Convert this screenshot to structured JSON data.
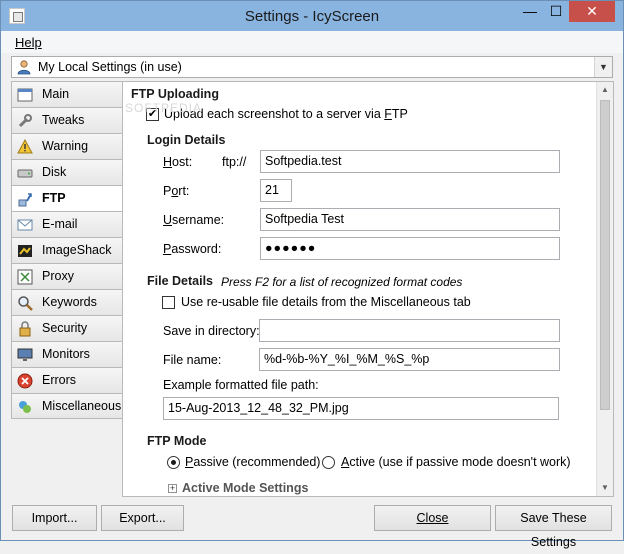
{
  "window": {
    "title": "Settings - IcyScreen"
  },
  "title_controls": {
    "minimize": "—",
    "maximize": "☐",
    "close": "✕"
  },
  "menu": {
    "help": "Help"
  },
  "profile": {
    "selected": "My Local Settings (in use)"
  },
  "watermark": "SOFTPEDIA",
  "sidebar": {
    "items": [
      {
        "label": "Main",
        "icon": "main-icon"
      },
      {
        "label": "Tweaks",
        "icon": "wrench-icon"
      },
      {
        "label": "Warning",
        "icon": "warning-icon"
      },
      {
        "label": "Disk",
        "icon": "disk-icon"
      },
      {
        "label": "FTP",
        "icon": "ftp-icon"
      },
      {
        "label": "E-mail",
        "icon": "email-icon"
      },
      {
        "label": "ImageShack",
        "icon": "imageshack-icon"
      },
      {
        "label": "Proxy",
        "icon": "proxy-icon"
      },
      {
        "label": "Keywords",
        "icon": "magnifier-icon"
      },
      {
        "label": "Security",
        "icon": "lock-icon"
      },
      {
        "label": "Monitors",
        "icon": "monitor-icon"
      },
      {
        "label": "Errors",
        "icon": "error-icon"
      },
      {
        "label": "Miscellaneous",
        "icon": "misc-icon"
      }
    ],
    "active": "FTP"
  },
  "ftp": {
    "section_title": "FTP Uploading",
    "upload_checkbox": {
      "label_pre": "Upload each screenshot to a server via ",
      "label_underlined": "F",
      "label_post": "TP",
      "checked": true
    },
    "login_title": "Login Details",
    "host": {
      "label_pre": "",
      "label_u": "H",
      "label_post": "ost:",
      "prefix": "ftp://",
      "value": "Softpedia.test"
    },
    "port": {
      "label_pre": "P",
      "label_u": "o",
      "label_post": "rt:",
      "value": "21"
    },
    "username": {
      "label_pre": "",
      "label_u": "U",
      "label_post": "sername:",
      "value": "Softpedia Test"
    },
    "password": {
      "label_pre": "",
      "label_u": "P",
      "label_post": "assword:",
      "value": "●●●●●●"
    },
    "file_title": "File Details",
    "file_hint": "Press F2 for a list of recognized format codes",
    "reuse_checkbox": {
      "label": "Use re-usable file details from the Miscellaneous tab",
      "checked": false
    },
    "save_dir": {
      "label": "Save in directory:",
      "value": ""
    },
    "file_name": {
      "label": "File name:",
      "value": "%d-%b-%Y_%I_%M_%S_%p"
    },
    "example_label": "Example formatted file path:",
    "example_value": "15-Aug-2013_12_48_32_PM.jpg",
    "mode_title": "FTP Mode",
    "passive": {
      "label_pre": "",
      "label_u": "P",
      "label_post": "assive (recommended)",
      "selected": true
    },
    "active": {
      "label_pre": "",
      "label_u": "A",
      "label_post": "ctive (use if passive mode doesn't work)",
      "selected": false
    },
    "active_settings": "Active Mode Settings"
  },
  "buttons": {
    "import": "Import...",
    "export": "Export...",
    "close": "Close",
    "save": "Save These Settings"
  },
  "colors": {
    "titlebar": "#89b4e0",
    "close_button": "#c7504b"
  }
}
